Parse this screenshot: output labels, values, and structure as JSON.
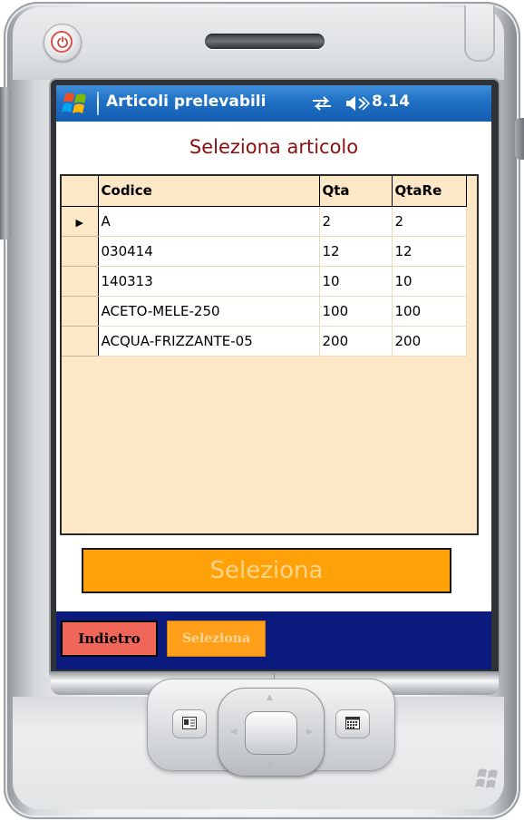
{
  "status_bar": {
    "app_title": "Articoli prelevabili",
    "clock": "8.14",
    "icons": [
      "windows-start-icon",
      "sync-icon",
      "speaker-icon"
    ]
  },
  "form": {
    "title": "Seleziona articolo"
  },
  "grid": {
    "columns": [
      "Codice",
      "Qta",
      "QtaRe"
    ],
    "rows": [
      {
        "codice": "A",
        "qta": "2",
        "qtare": "2",
        "current": true
      },
      {
        "codice": "030414",
        "qta": "12",
        "qtare": "12",
        "current": false
      },
      {
        "codice": "140313",
        "qta": "10",
        "qtare": "10",
        "current": false
      },
      {
        "codice": "ACETO-MELE-250",
        "qta": "100",
        "qtare": "100",
        "current": false
      },
      {
        "codice": "ACQUA-FRIZZANTE-05",
        "qta": "200",
        "qtare": "200",
        "current": false
      }
    ],
    "current_row_marker": "▶"
  },
  "main_button": {
    "label": "Seleziona"
  },
  "softkeys": {
    "left": "Indietro",
    "right": "Seleziona"
  },
  "colors": {
    "titlebar": "#1f6fc4",
    "form_title": "#8c0f0f",
    "grid_background": "#fce7c7",
    "main_button": "#ffa20a",
    "softbar": "#0b1b7d",
    "softkey_left": "#f0675a",
    "softkey_right": "#ff9f1a"
  }
}
